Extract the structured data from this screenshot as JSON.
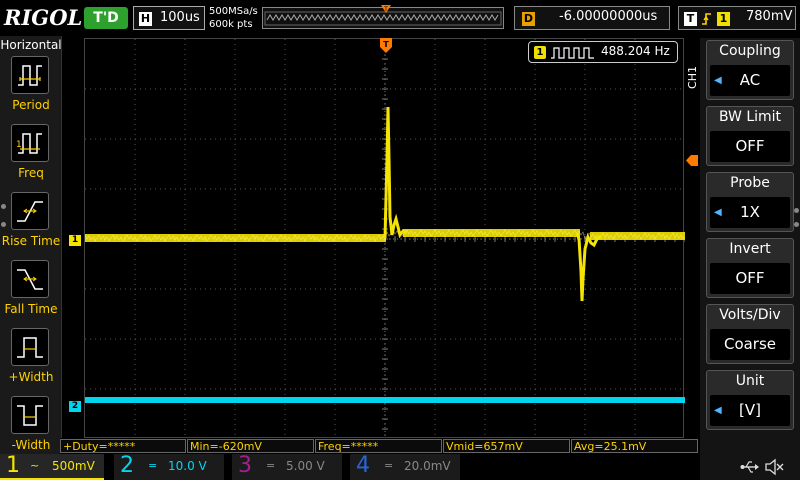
{
  "header": {
    "logo": "RIGOL",
    "run_status": "T'D",
    "horizontal_letter": "H",
    "timebase": "100us",
    "sample_rate": "500MSa/s",
    "memory_depth": "600k pts",
    "delay_letter": "D",
    "delay_value": "-6.00000000us",
    "trigger_letter": "T",
    "trigger_channel": "1",
    "trigger_level": "780mV",
    "trigger_slope_icon": "rising-edge-icon"
  },
  "left_menu": {
    "title": "Horizontal",
    "items": [
      {
        "label": "Period",
        "icon": "period-icon"
      },
      {
        "label": "Freq",
        "icon": "frequency-icon"
      },
      {
        "label": "Rise Time",
        "icon": "rise-time-icon"
      },
      {
        "label": "Fall Time",
        "icon": "fall-time-icon"
      },
      {
        "label": "+Width",
        "icon": "positive-width-icon"
      },
      {
        "label": "-Width",
        "icon": "negative-width-icon"
      }
    ]
  },
  "frequency_counter": {
    "channel": "1",
    "value": "488.204 Hz"
  },
  "channel_markers": {
    "ch1": "1",
    "ch2": "2"
  },
  "right_menu": {
    "channel_label": "CH1",
    "items": [
      {
        "title": "Coupling",
        "value": "AC",
        "has_arrow": true
      },
      {
        "title": "BW Limit",
        "value": "OFF",
        "has_arrow": false
      },
      {
        "title": "Probe",
        "value": "1X",
        "has_arrow": true
      },
      {
        "title": "Invert",
        "value": "OFF",
        "has_arrow": false
      },
      {
        "title": "Volts/Div",
        "value": "Coarse",
        "has_arrow": false
      },
      {
        "title": "Unit",
        "value": "[V]",
        "has_arrow": true
      }
    ]
  },
  "measurements": [
    "+Duty=*****",
    "Min=-620mV",
    "Freq=*****",
    "Vmid=657mV",
    "Avg=25.1mV"
  ],
  "channels": [
    {
      "num": "1",
      "coupling": "~",
      "scale": "500mV",
      "color": "#f5e400",
      "active": true
    },
    {
      "num": "2",
      "coupling": "=",
      "scale": "10.0 V",
      "color": "#00d5f0",
      "active": true
    },
    {
      "num": "3",
      "coupling": "=",
      "scale": "5.00 V",
      "color": "#a0208f",
      "active": false
    },
    {
      "num": "4",
      "coupling": "=",
      "scale": "20.0mV",
      "color": "#2866d8",
      "active": false
    }
  ],
  "status_icons": [
    "usb-icon",
    "speaker-muted-icon"
  ],
  "colors": {
    "ch1": "#f5e400",
    "ch2": "#00d5f0",
    "trigger": "#ff7a00",
    "run_status": "#2ea02e"
  }
}
